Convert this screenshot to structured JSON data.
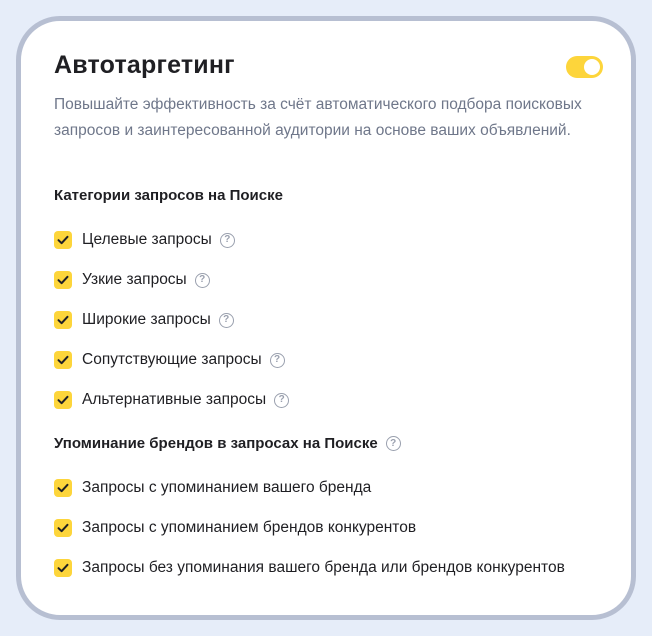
{
  "title": "Автотаргетинг",
  "toggle_on": true,
  "description": "Повышайте эффективность за счёт автоматического подбора поисковых запросов и заинтересованной аудитории на основе ваших объявлений.",
  "section1": {
    "title": "Категории запросов на Поиске",
    "items": [
      {
        "label": "Целевые запросы",
        "checked": true,
        "help_icon": "question-circle"
      },
      {
        "label": "Узкие запросы",
        "checked": true,
        "help_icon": "question-circle"
      },
      {
        "label": "Широкие запросы",
        "checked": true,
        "help_icon": "question-circle"
      },
      {
        "label": "Сопутствующие запросы",
        "checked": true,
        "help_icon": "question-circle"
      },
      {
        "label": "Альтернативные запросы",
        "checked": true,
        "help_icon": "question-circle"
      }
    ]
  },
  "section2": {
    "title": "Упоминание брендов в запросах на Поиске",
    "help_icon": "question-circle",
    "items": [
      {
        "label": "Запросы с упоминанием вашего бренда",
        "checked": true
      },
      {
        "label": "Запросы с упоминанием брендов конкурентов",
        "checked": true
      },
      {
        "label": "Запросы без упоминания вашего бренда или брендов конкурентов",
        "checked": true
      }
    ]
  },
  "colors": {
    "accent": "#fdd53b",
    "background": "#e6edf9",
    "frame": "#b7bfd2",
    "text": "#1f1f23",
    "muted": "#6f778a"
  },
  "help_glyph": "?"
}
